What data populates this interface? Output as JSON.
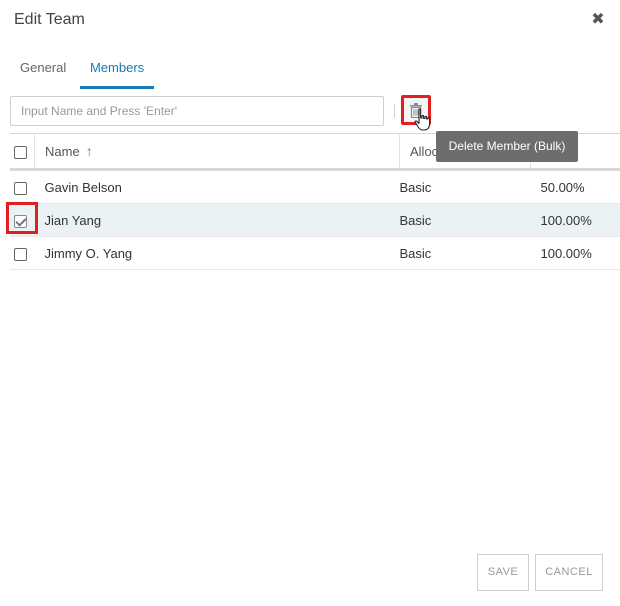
{
  "dialog": {
    "title": "Edit Team",
    "close_glyph": "✖"
  },
  "tabs": [
    {
      "label": "General",
      "active": false
    },
    {
      "label": "Members",
      "active": true
    }
  ],
  "member_input": {
    "value": "",
    "placeholder": "Input Name and Press 'Enter'"
  },
  "toolbar": {
    "delete_icon": "trash-icon",
    "tooltip": "Delete Member (Bulk)"
  },
  "table": {
    "columns": {
      "name": "Name",
      "allocation": "Allocation",
      "percent": ""
    },
    "sort_glyph": "↑",
    "rows": [
      {
        "name": "Gavin Belson",
        "allocation": "Basic",
        "percent": "50.00%",
        "checked": false
      },
      {
        "name": "Jian Yang",
        "allocation": "Basic",
        "percent": "100.00%",
        "checked": true
      },
      {
        "name": "Jimmy O. Yang",
        "allocation": "Basic",
        "percent": "100.00%",
        "checked": false
      }
    ]
  },
  "footer": {
    "save_label": "SAVE",
    "cancel_label": "CANCEL"
  },
  "colors": {
    "accent": "#1a7ab5",
    "highlight": "#e02020",
    "tooltip_bg": "#6d6d6d",
    "selected_row": "#eaf2f5"
  }
}
